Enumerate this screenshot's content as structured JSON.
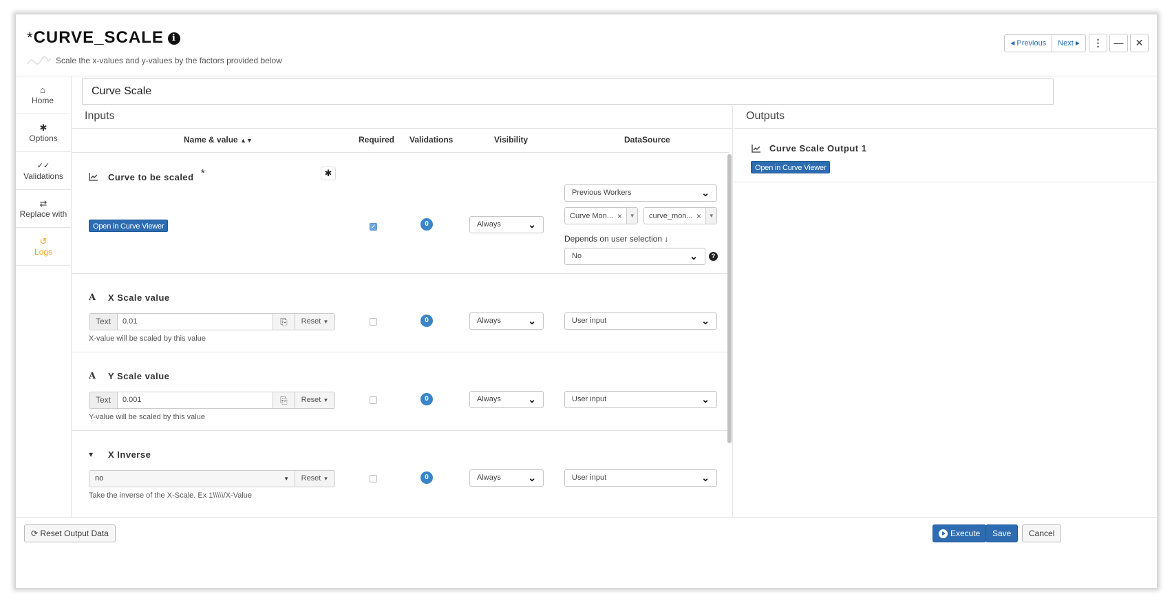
{
  "header": {
    "modified_marker": "*",
    "title": "CURVE_SCALE",
    "subtitle": "Scale the x-values and y-values by the factors provided below",
    "previous_label": "Previous",
    "next_label": "Next"
  },
  "rail": {
    "items": [
      {
        "label": "Home",
        "icon": "home-icon"
      },
      {
        "label": "Options",
        "icon": "gear-icon"
      },
      {
        "label": "Validations",
        "icon": "double-check-icon"
      },
      {
        "label": "Replace with",
        "icon": "swap-icon"
      },
      {
        "label": "Logs",
        "icon": "history-icon"
      }
    ]
  },
  "name_field": {
    "value": "Curve Scale"
  },
  "inputs": {
    "section_title": "Inputs",
    "columns": {
      "name_value": "Name & value",
      "required": "Required",
      "validations": "Validations",
      "visibility": "Visibility",
      "datasource": "DataSource"
    },
    "params": [
      {
        "title": "Curve to be scaled",
        "required_marker": "*",
        "button": "Open in Curve Viewer",
        "required": true,
        "validations": "0",
        "visibility": "Always",
        "datasource": "Previous Workers",
        "worker_tag": "Curve Mon...",
        "output_tag": "curve_mon...",
        "depends_label": "Depends on user selection",
        "depends_value": "No"
      },
      {
        "title": "X Scale value",
        "type_label": "Text",
        "value": "0.01",
        "reset_label": "Reset",
        "hint": "X-value will be scaled by this value",
        "required": false,
        "validations": "0",
        "visibility": "Always",
        "datasource": "User input"
      },
      {
        "title": "Y Scale value",
        "type_label": "Text",
        "value": "0.001",
        "reset_label": "Reset",
        "hint": "Y-value will be scaled by this value",
        "required": false,
        "validations": "0",
        "visibility": "Always",
        "datasource": "User input"
      },
      {
        "title": "X Inverse",
        "value": "no",
        "reset_label": "Reset",
        "hint": "Take the inverse of the X-Scale. Ex 1\\\\\\\\\\/X-Value",
        "required": false,
        "validations": "0",
        "visibility": "Always",
        "datasource": "User input"
      }
    ]
  },
  "outputs": {
    "section_title": "Outputs",
    "items": [
      {
        "title": "Curve Scale Output 1",
        "button": "Open in Curve Viewer"
      }
    ]
  },
  "footer": {
    "reset_output": "Reset Output Data",
    "execute": "Execute",
    "save": "Save",
    "cancel": "Cancel"
  }
}
